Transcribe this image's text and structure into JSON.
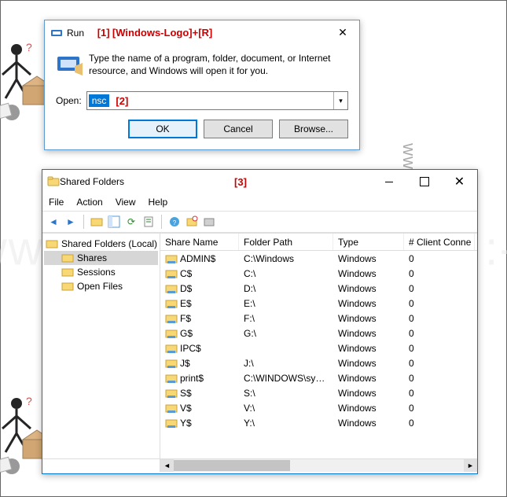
{
  "annotations": {
    "a1": "[1]",
    "hint1": "[Windows-Logo]+[R]",
    "a2": "[2]",
    "a3": "[3]"
  },
  "watermark": "www.SoftwareOK.com :-)",
  "run": {
    "title": "Run",
    "description": "Type the name of a program, folder, document, or Internet resource, and Windows will open it for you.",
    "open_label": "Open:",
    "input_value": "nsc",
    "buttons": {
      "ok": "OK",
      "cancel": "Cancel",
      "browse": "Browse..."
    }
  },
  "shared": {
    "title": "Shared Folders",
    "menu": {
      "file": "File",
      "action": "Action",
      "view": "View",
      "help": "Help"
    },
    "tree": {
      "root": "Shared Folders (Local)",
      "items": [
        "Shares",
        "Sessions",
        "Open Files"
      ],
      "selected": 0
    },
    "columns": [
      "Share Name",
      "Folder Path",
      "Type",
      "# Client Conne"
    ],
    "rows": [
      {
        "name": "ADMIN$",
        "path": "C:\\Windows",
        "type": "Windows",
        "clients": "0"
      },
      {
        "name": "C$",
        "path": "C:\\",
        "type": "Windows",
        "clients": "0"
      },
      {
        "name": "D$",
        "path": "D:\\",
        "type": "Windows",
        "clients": "0"
      },
      {
        "name": "E$",
        "path": "E:\\",
        "type": "Windows",
        "clients": "0"
      },
      {
        "name": "F$",
        "path": "F:\\",
        "type": "Windows",
        "clients": "0"
      },
      {
        "name": "G$",
        "path": "G:\\",
        "type": "Windows",
        "clients": "0"
      },
      {
        "name": "IPC$",
        "path": "",
        "type": "Windows",
        "clients": "0"
      },
      {
        "name": "J$",
        "path": "J:\\",
        "type": "Windows",
        "clients": "0"
      },
      {
        "name": "print$",
        "path": "C:\\WINDOWS\\syst...",
        "type": "Windows",
        "clients": "0"
      },
      {
        "name": "S$",
        "path": "S:\\",
        "type": "Windows",
        "clients": "0"
      },
      {
        "name": "V$",
        "path": "V:\\",
        "type": "Windows",
        "clients": "0"
      },
      {
        "name": "Y$",
        "path": "Y:\\",
        "type": "Windows",
        "clients": "0"
      }
    ]
  }
}
